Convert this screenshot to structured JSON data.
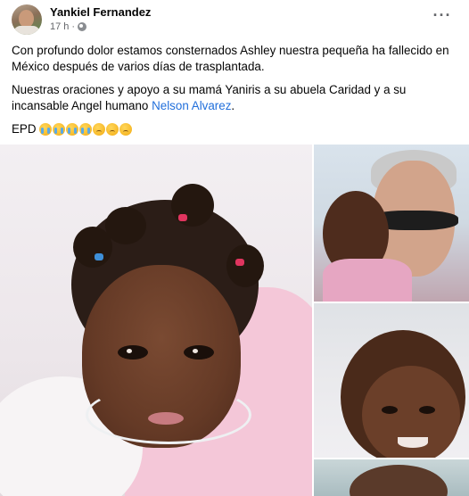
{
  "post": {
    "author_name": "Yankiel Fernandez",
    "time": "17 h",
    "separator": "·",
    "more_label": "···",
    "paragraph1": "Con  profundo dolor estamos consternados Ashley nuestra pequeña ha fallecido en México después de varios días de trasplantada.",
    "paragraph2_before_link": "Nuestras oraciones y apoyo a su mamá Yaniris a su abuela Caridad y a su incansable Angel humano ",
    "paragraph2_link": "Nelson Alvarez",
    "paragraph2_after_link": ".",
    "paragraph3": "EPD",
    "emojis": [
      "crying-face",
      "crying-face",
      "crying-face",
      "crying-face",
      "sad-face",
      "sad-face",
      "sad-face"
    ]
  },
  "colors": {
    "link": "#216fdb",
    "secondary_text": "#65676b",
    "primary_text": "#050505"
  },
  "icons": {
    "visibility": "globe-icon",
    "menu": "more-options-icon"
  }
}
